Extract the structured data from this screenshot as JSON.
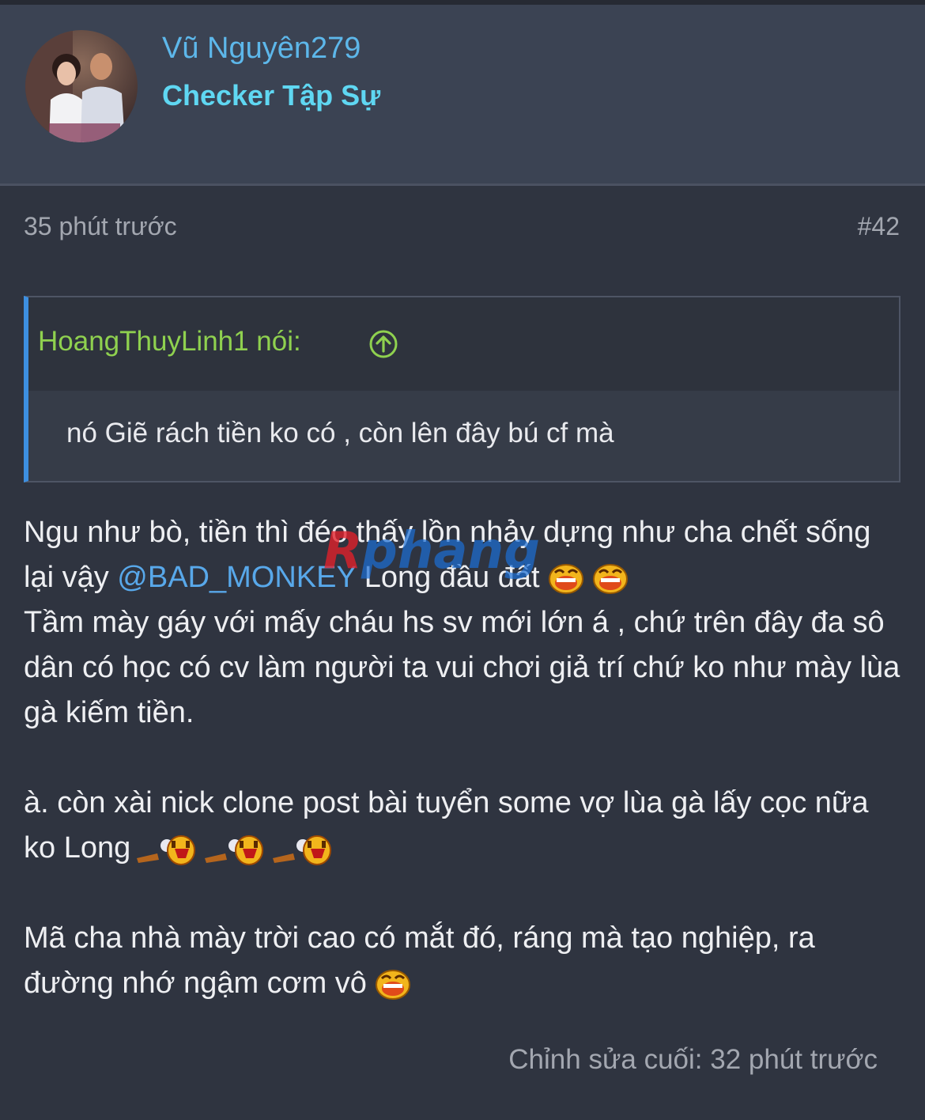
{
  "user": {
    "name": "Vũ Nguyên279",
    "title": "Checker Tập Sự"
  },
  "post": {
    "time": "35 phút trước",
    "number": "#42",
    "edited": "Chỉnh sửa cuối: 32 phút trước"
  },
  "quote": {
    "author": "HoangThuyLinh1 nói:",
    "text": "nó Giẽ rách tiền ko có , còn lên đây bú cf mà"
  },
  "body": {
    "line1_a": "Ngu như bò, tiền thì đéo thấy lồn nhảy dựng như cha chết sống lại vậy ",
    "mention": "@BAD_MONKEY",
    "line1_b": " Long đầu đất",
    "line2": "Tầm mày gáy với mấy cháu hs sv mới lớn á , chứ trên đây đa sô dân có học có cv làm người ta vui chơi giả trí chứ ko như mày lùa gà kiếm tiền.",
    "line3": "à. còn xài nick clone post bài tuyển some vợ lùa gà lấy cọc nữa ko Long",
    "line4": "Mã cha nhà mày trời cao có mắt đó, ráng mà tạo nghiệp, ra đường nhớ ngậm cơm vô"
  },
  "watermark": "Rphang",
  "icons": [
    "quote-arrow-up-icon",
    "laugh-emoji-icon",
    "gun-emoji-icon"
  ],
  "colors": {
    "background": "#2f3440",
    "header": "#3b4353",
    "username": "#5db7ea",
    "title": "#5fd7f2",
    "quote_author": "#8fd14f",
    "quote_bar": "#3d8fe0",
    "mention": "#58a8ea"
  }
}
